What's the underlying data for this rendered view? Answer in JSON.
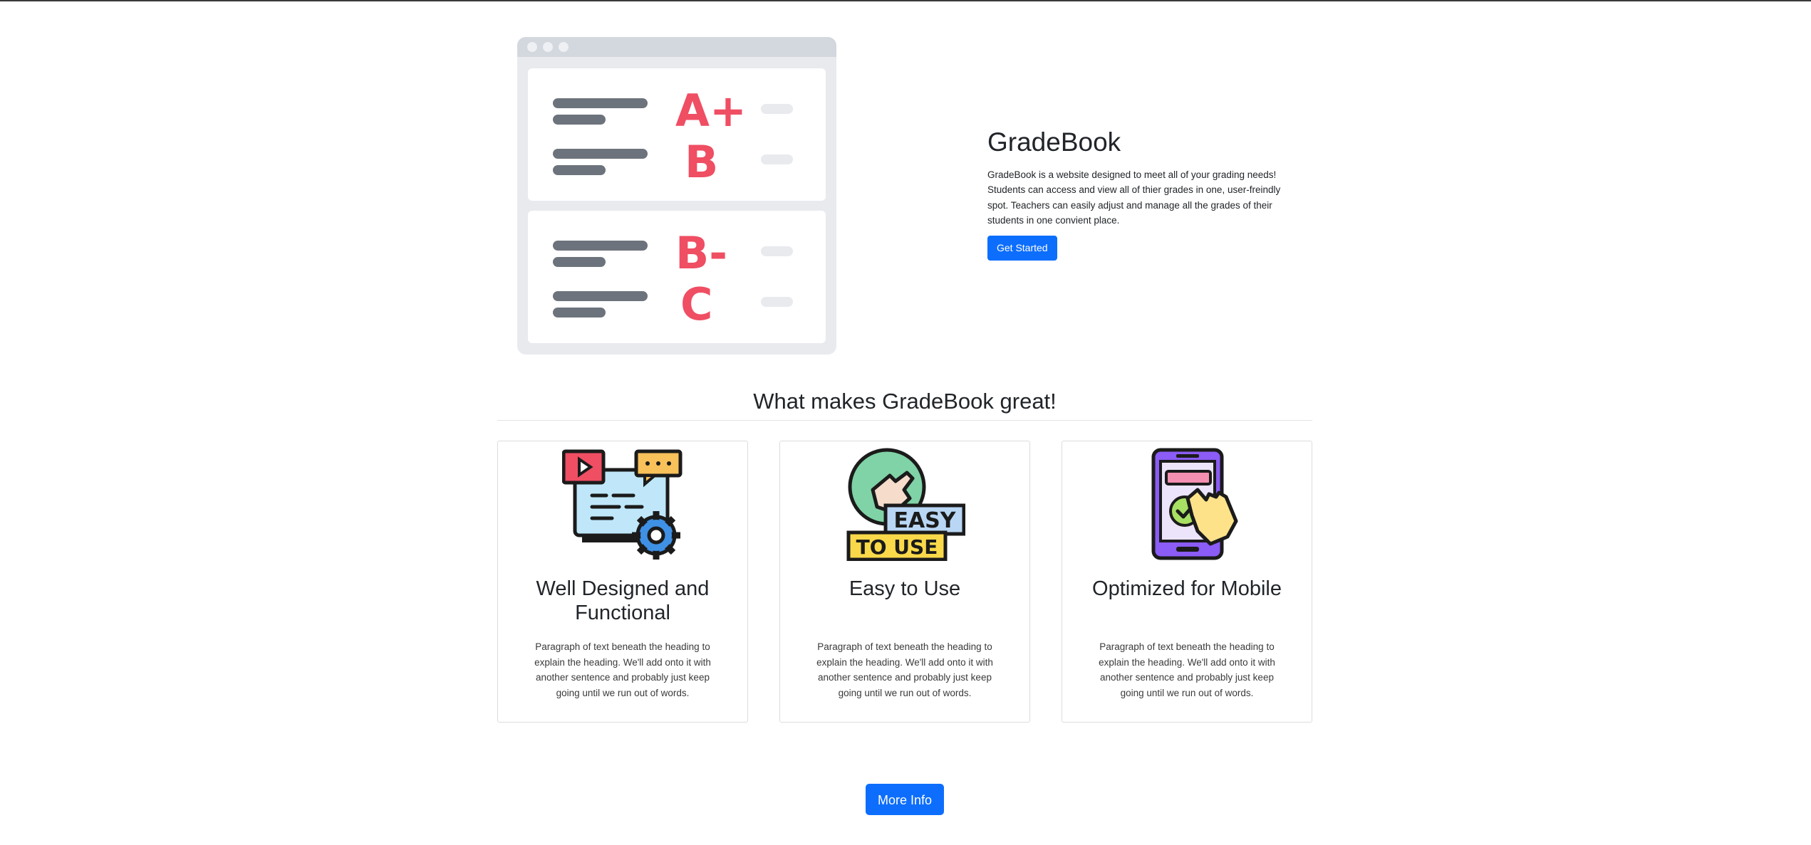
{
  "hero": {
    "illustration_grades": [
      "A+",
      "B",
      "B-",
      "C"
    ],
    "title": "GradeBook",
    "description": "GradeBook is a website designed to meet all of your grading needs! Students can access and view all of thier grades in one, user-freindly spot. Teachers can easily adjust and manage all the grades of their students in one convient place.",
    "cta_label": "Get Started"
  },
  "features": {
    "heading": "What makes GradeBook great!",
    "cards": [
      {
        "icon": "settings-screen-icon",
        "title": "Well Designed and Functional",
        "text": "Paragraph of text beneath the heading to explain the heading. We'll add onto it with another sentence and probably just keep going until we run out of words."
      },
      {
        "icon": "easy-to-use-icon",
        "title": "Easy to Use",
        "badge_top": "EASY",
        "badge_bottom": "TO USE",
        "text": "Paragraph of text beneath the heading to explain the heading. We'll add onto it with another sentence and probably just keep going until we run out of words."
      },
      {
        "icon": "mobile-tap-icon",
        "title": "Optimized for Mobile",
        "text": "Paragraph of text beneath the heading to explain the heading. We'll add onto it with another sentence and probably just keep going until we run out of words."
      }
    ]
  },
  "more_info_label": "More Info",
  "colors": {
    "primary": "#0d6efd",
    "grade_red": "#ef4e63",
    "line_gray": "#6c737c",
    "frame_gray": "#d3d7de"
  }
}
